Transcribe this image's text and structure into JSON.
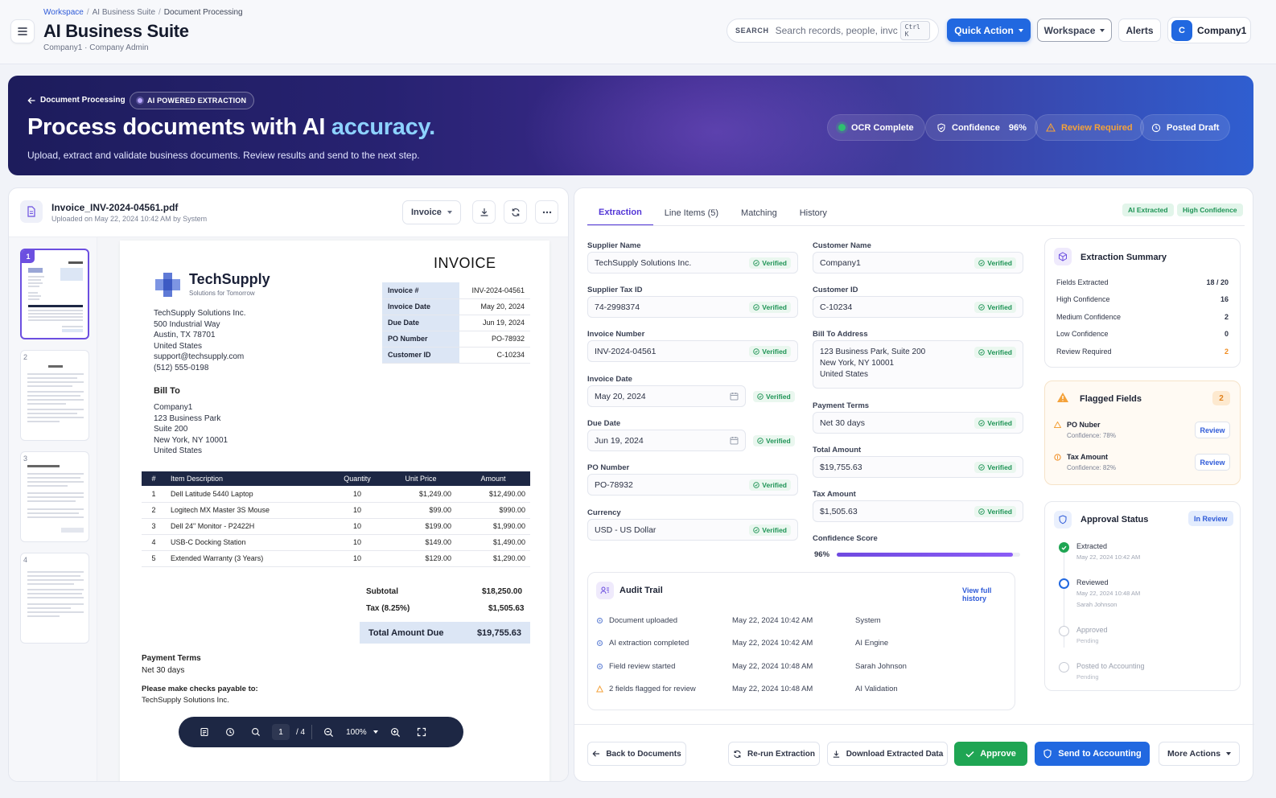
{
  "header": {
    "breadcrumb": [
      "Workspace",
      "AI Business Suite",
      "Document Processing"
    ],
    "title": "AI Business Suite",
    "subtitle": "Company1 · Company Admin",
    "search_label": "SEARCH",
    "search_placeholder": "Search records, people, invc",
    "search_shortcut": "Ctrl K",
    "quick_action": "Quick Action",
    "workspace": "Workspace",
    "alerts": "Alerts",
    "company_initial": "C",
    "company_name": "Company1"
  },
  "hero": {
    "back_label": "Document Processing",
    "chip_label": "AI POWERED EXTRACTION",
    "title_main": "Process documents with AI ",
    "title_accent": "accuracy.",
    "subtitle": "Upload, extract and validate business documents. Review results and send to the next step.",
    "pills": {
      "ocr": "OCR Complete",
      "confidence_label": "Confidence",
      "confidence_value": "96%",
      "review": "Review Required",
      "posted": "Posted Draft"
    },
    "colors": {
      "accent": "#8dd2ff",
      "warning": "#f4a23a",
      "ocr_dot": "#2fbf71"
    }
  },
  "document": {
    "file_name": "Invoice_INV-2024-04561.pdf",
    "file_meta": "Uploaded on May 22, 2024 10:42 AM by System",
    "doc_type": "Invoice",
    "thumbnails": [
      "1",
      "2",
      "3",
      "4"
    ],
    "page": {
      "brand": "TechSupply",
      "tagline": "Solutions for Tomorrow",
      "heading": "INVOICE",
      "from_lines": [
        "TechSupply Solutions Inc.",
        "500 Industrial Way",
        "Austin, TX 78701",
        "United States",
        "support@techsupply.com",
        "(512) 555-0198"
      ],
      "bill_to_label": "Bill To",
      "bill_to_lines": [
        "Company1",
        "123 Business Park",
        "Suite 200",
        "New York, NY 10001",
        "United States"
      ],
      "meta": [
        {
          "k": "Invoice #",
          "v": "INV-2024-04561"
        },
        {
          "k": "Invoice Date",
          "v": "May 20, 2024"
        },
        {
          "k": "Due Date",
          "v": "Jun 19, 2024"
        },
        {
          "k": "PO Number",
          "v": "PO-78932"
        },
        {
          "k": "Customer ID",
          "v": "C-10234"
        }
      ],
      "items_headers": [
        "#",
        "Item Description",
        "Quantity",
        "Unit Price",
        "Amount"
      ],
      "items": [
        [
          "1",
          "Dell Latitude 5440 Laptop",
          "10",
          "$1,249.00",
          "$12,490.00"
        ],
        [
          "2",
          "Logitech MX Master 3S Mouse",
          "10",
          "$99.00",
          "$990.00"
        ],
        [
          "3",
          "Dell 24\" Monitor - P2422H",
          "10",
          "$199.00",
          "$1,990.00"
        ],
        [
          "4",
          "USB-C Docking Station",
          "10",
          "$149.00",
          "$1,490.00"
        ],
        [
          "5",
          "Extended Warranty (3 Years)",
          "10",
          "$129.00",
          "$1,290.00"
        ]
      ],
      "subtotal_label": "Subtotal",
      "subtotal": "$18,250.00",
      "tax_label": "Tax (8.25%)",
      "tax": "$1,505.63",
      "total_label": "Total Amount Due",
      "total": "$19,755.63",
      "terms_label": "Payment Terms",
      "terms": "Net 30 days",
      "payable_label": "Please make checks payable to:",
      "payable": "TechSupply Solutions Inc."
    },
    "toolbar": {
      "page": "1",
      "of": "/ 4",
      "zoom": "100%"
    }
  },
  "extraction": {
    "tabs": [
      "Extraction",
      "Line Items (5)",
      "Matching",
      "History"
    ],
    "badges": [
      "AI Extracted",
      "High Confidence"
    ],
    "verified": "Verified",
    "left_fields": [
      {
        "label": "Supplier Name",
        "value": "TechSupply Solutions Inc."
      },
      {
        "label": "Supplier Tax ID",
        "value": "74-2998374"
      },
      {
        "label": "Invoice Number",
        "value": "INV-2024-04561"
      },
      {
        "label": "Invoice Date",
        "value": "May 20, 2024"
      },
      {
        "label": "Due Date",
        "value": "Jun 19, 2024"
      },
      {
        "label": "PO Number",
        "value": "PO-78932"
      },
      {
        "label": "Currency",
        "value": "USD - US Dollar"
      }
    ],
    "right_fields": {
      "customer_name": {
        "label": "Customer Name",
        "value": "Company1"
      },
      "customer_id": {
        "label": "Customer ID",
        "value": "C-10234"
      },
      "bill_to": {
        "label": "Bill To Address",
        "lines": [
          "123 Business Park, Suite 200",
          "New York, NY 10001",
          "United States"
        ]
      },
      "payment_terms": {
        "label": "Payment Terms",
        "value": "Net 30 days"
      },
      "total_amount": {
        "label": "Total Amount",
        "value": "$19,755.63"
      },
      "tax_amount": {
        "label": "Tax Amount",
        "value": "$1,505.63"
      }
    },
    "confidence_label": "Confidence Score",
    "confidence_value": "96%",
    "confidence_fraction": 0.96,
    "audit": {
      "title": "Audit Trail",
      "link": "View full history",
      "rows": [
        {
          "event": "Document uploaded",
          "time": "May 22, 2024 10:42 AM",
          "actor": "System",
          "kind": "done"
        },
        {
          "event": "AI extraction completed",
          "time": "May 22, 2024 10:42 AM",
          "actor": "AI Engine",
          "kind": "done"
        },
        {
          "event": "Field review started",
          "time": "May 22, 2024 10:48 AM",
          "actor": "Sarah Johnson",
          "kind": "done"
        },
        {
          "event": "2 fields flagged for review",
          "time": "May 22, 2024 10:48 AM",
          "actor": "AI Validation",
          "kind": "warn"
        }
      ]
    }
  },
  "summary": {
    "title": "Extraction Summary",
    "rows": [
      {
        "k": "Fields Extracted",
        "v": "18 / 20"
      },
      {
        "k": "High Confidence",
        "v": "16"
      },
      {
        "k": "Medium Confidence",
        "v": "2"
      },
      {
        "k": "Low Confidence",
        "v": "0"
      },
      {
        "k": "Review Required",
        "v": "2"
      }
    ]
  },
  "flagged": {
    "title": "Flagged Fields",
    "count": "2",
    "items": [
      {
        "name": "PO Nuber",
        "conf": "Confidence: 78%",
        "action": "Review"
      },
      {
        "name": "Tax Amount",
        "conf": "Confidence: 82%",
        "action": "Review"
      }
    ]
  },
  "approval": {
    "title": "Approval Status",
    "status": "In Review",
    "steps": [
      {
        "name": "Extracted",
        "detail": "May 22, 2024 10:42 AM",
        "state": "done"
      },
      {
        "name": "Reviewed",
        "detail": "May 22, 2024 10:48 AM",
        "detail2": "Sarah Johnson",
        "state": "current"
      },
      {
        "name": "Approved",
        "detail": "Pending",
        "state": "pending"
      },
      {
        "name": "Posted to Accounting",
        "detail": "Pending",
        "state": "pending"
      }
    ]
  },
  "actions": {
    "back": "Back to Documents",
    "rerun": "Re-run Extraction",
    "download": "Download Extracted Data",
    "approve": "Approve",
    "send": "Send to Accounting",
    "more": "More Actions"
  }
}
